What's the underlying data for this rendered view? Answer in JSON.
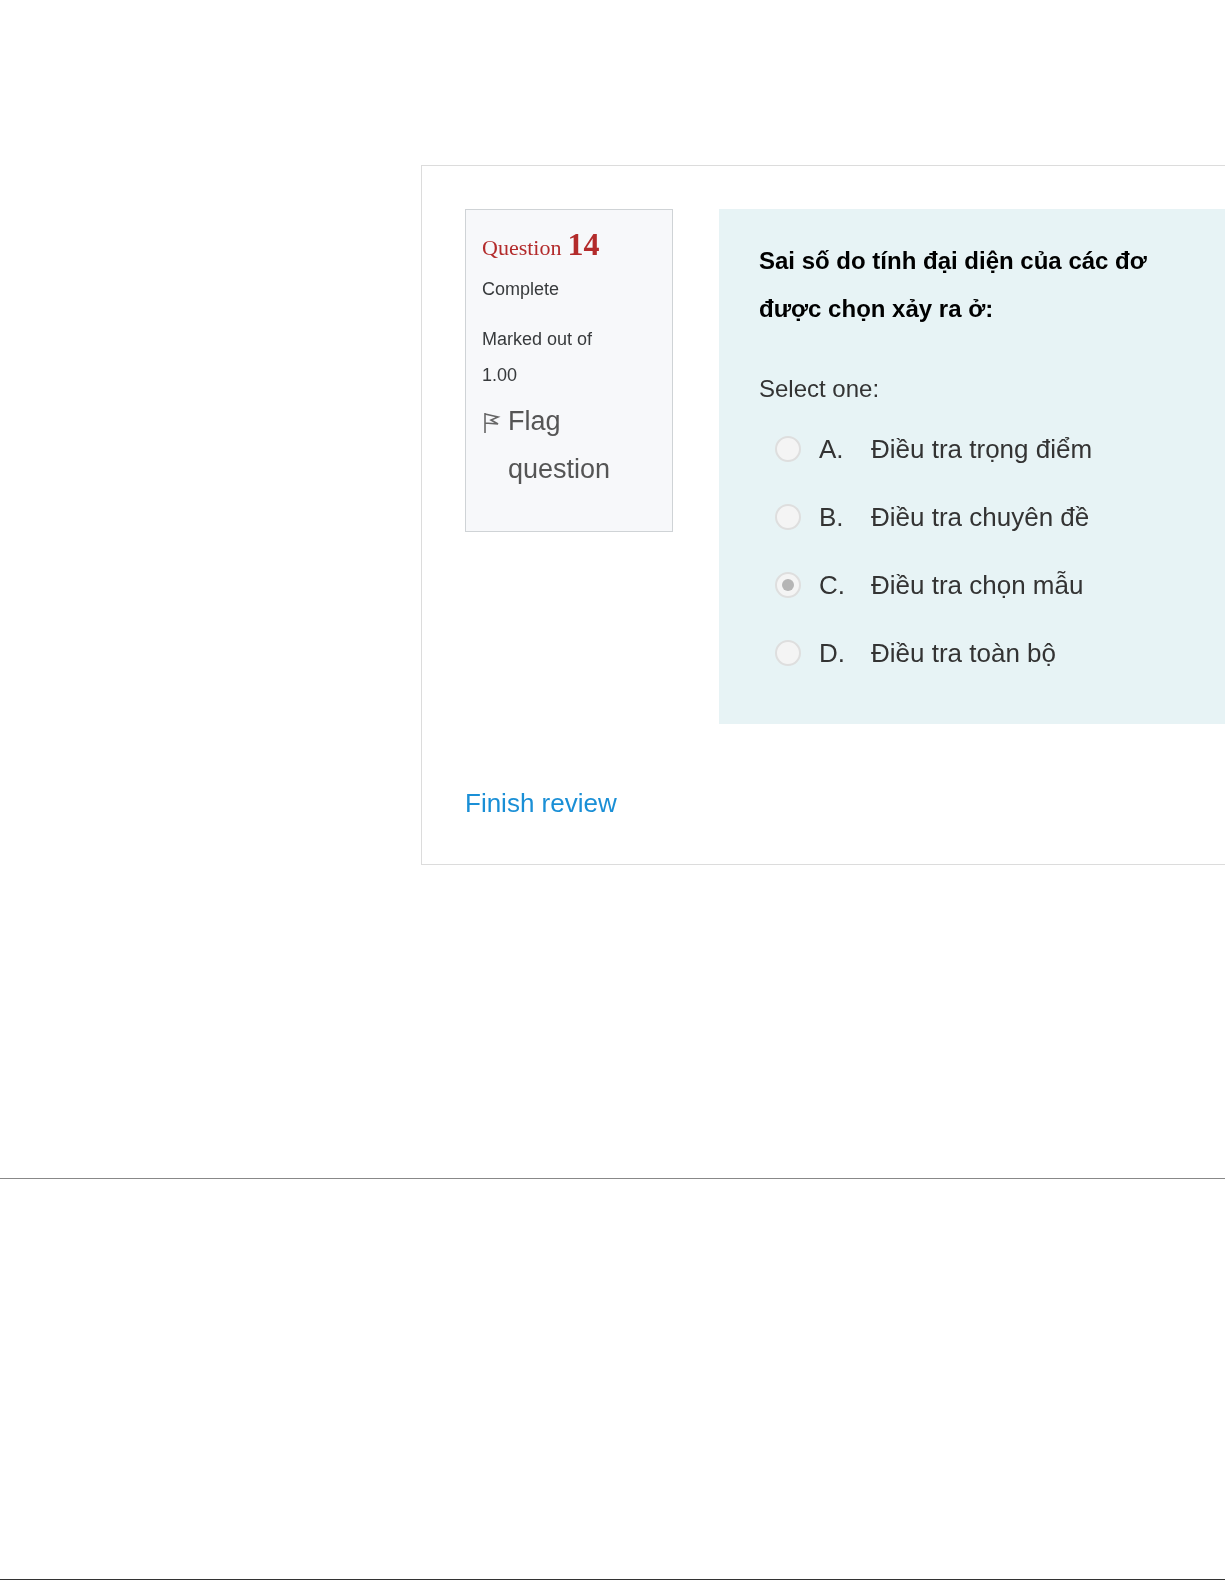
{
  "question_info": {
    "label": "Question",
    "number": "14",
    "status": "Complete",
    "mark_lines": [
      "Marked out of",
      "1.00"
    ],
    "flag_label": "Flag question"
  },
  "question": {
    "text_lines": [
      "Sai số do tính đại diện của các đơ",
      "được chọn xảy ra ở:"
    ],
    "prompt": "Select one:",
    "options": [
      {
        "letter": "A.",
        "text": "Điều tra trọng điểm",
        "selected": false
      },
      {
        "letter": "B.",
        "text": "Điều tra chuyên đề",
        "selected": false
      },
      {
        "letter": "C.",
        "text": "Điều tra chọn mẫu",
        "selected": true
      },
      {
        "letter": "D.",
        "text": "Điều tra toàn bộ",
        "selected": false
      }
    ]
  },
  "finish_link": "Finish review"
}
